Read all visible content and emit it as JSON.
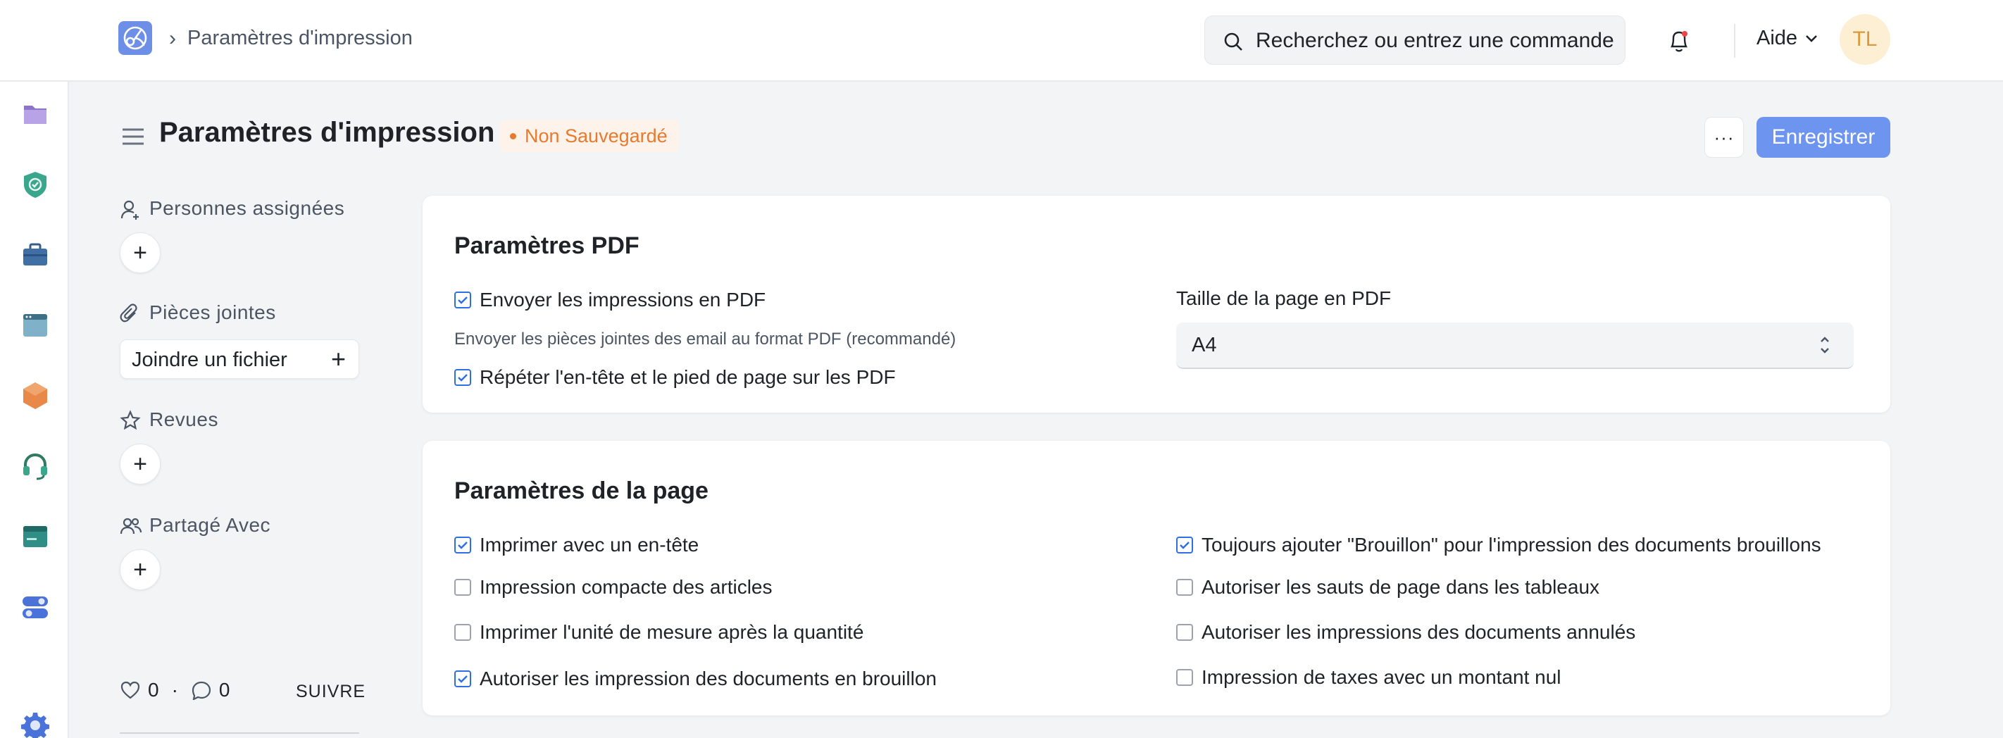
{
  "navbar": {
    "breadcrumb_sep": "›",
    "breadcrumb": "Paramètres d'impression",
    "search_placeholder": "Recherchez ou entrez une commande",
    "help_label": "Aide",
    "avatar_initials": "TL"
  },
  "header": {
    "title": "Paramètres d'impression",
    "status_badge": "Non Sauvegardé",
    "more_label": "···",
    "save_label": "Enregistrer"
  },
  "sidebar": {
    "assigned_label": "Personnes assignées",
    "attachments_label": "Pièces jointes",
    "attach_button": "Joindre un fichier",
    "reviews_label": "Revues",
    "shared_label": "Partagé Avec",
    "likes_count": "0",
    "stats_sep": "·",
    "comments_count": "0",
    "follow_label": "SUIVRE"
  },
  "pdf_section": {
    "title": "Paramètres PDF",
    "send_as_pdf": {
      "label": "Envoyer les impressions en PDF",
      "checked": true
    },
    "send_as_pdf_help": "Envoyer les pièces jointes des email au format PDF (recommandé)",
    "repeat_header_footer": {
      "label": "Répéter l'en-tête et le pied de page sur les PDF",
      "checked": true
    },
    "page_size_label": "Taille de la page en PDF",
    "page_size_value": "A4"
  },
  "page_section": {
    "title": "Paramètres de la page",
    "left": [
      {
        "label": "Imprimer avec un en-tête",
        "checked": true
      },
      {
        "label": "Impression compacte des articles",
        "checked": false
      },
      {
        "label": "Imprimer l'unité de mesure après la quantité",
        "checked": false
      },
      {
        "label": "Autoriser les impression des documents en brouillon",
        "checked": true
      }
    ],
    "right": [
      {
        "label": "Toujours ajouter \"Brouillon\" pour l'impression des documents brouillons",
        "checked": true
      },
      {
        "label": "Autoriser les sauts de page dans les tableaux",
        "checked": false
      },
      {
        "label": "Autoriser les impressions des documents annulés",
        "checked": false
      },
      {
        "label": "Impression de taxes avec un montant nul",
        "checked": false
      }
    ]
  },
  "colors": {
    "primary": "#6d95f0",
    "unsaved": "#e67b2f",
    "checkbox_checked": "#2f6fe4"
  }
}
